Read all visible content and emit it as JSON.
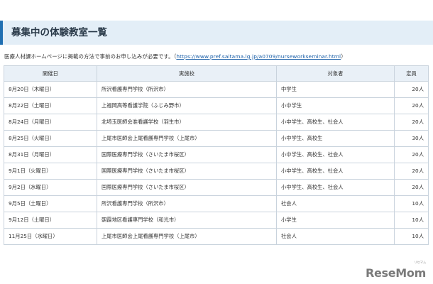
{
  "page_title": "募集中の体験教室一覧",
  "intro": {
    "text": "医療人材課ホームページに掲載の方法で事前のお申し込みが必要です。（",
    "link": "https://www.pref.saitama.lg.jp/a0709/nurseworkseminar.html",
    "suffix": "）"
  },
  "table": {
    "headers": {
      "date": "開催日",
      "school": "実施校",
      "target": "対象者",
      "capacity": "定員"
    },
    "rows": [
      {
        "date": "8月20日（木曜日）",
        "school": "所沢看護専門学校（所沢市）",
        "target": "中学生",
        "capacity": "20人"
      },
      {
        "date": "8月22日（土曜日）",
        "school": "上福岡高等看護学院（ふじみ野市）",
        "target": "小中学生",
        "capacity": "20人"
      },
      {
        "date": "8月24日（月曜日）",
        "school": "北埼玉医師会准看護学校（羽生市）",
        "target": "小中学生、高校生、社会人",
        "capacity": "20人"
      },
      {
        "date": "8月25日（火曜日）",
        "school": "上尾市医師会上尾看護専門学校（上尾市）",
        "target": "小中学生、高校生",
        "capacity": "30人"
      },
      {
        "date": "8月31日（月曜日）",
        "school": "国際医療専門学校（さいたま市桜区）",
        "target": "小中学生、高校生、社会人",
        "capacity": "20人"
      },
      {
        "date": "9月1日（火曜日）",
        "school": "国際医療専門学校（さいたま市桜区）",
        "target": "小中学生、高校生、社会人",
        "capacity": "20人"
      },
      {
        "date": "9月2日（水曜日）",
        "school": "国際医療専門学校（さいたま市桜区）",
        "target": "小中学生、高校生、社会人",
        "capacity": "20人"
      },
      {
        "date": "9月5日（土曜日）",
        "school": "所沢看護専門学校（所沢市）",
        "target": "社会人",
        "capacity": "10人"
      },
      {
        "date": "9月12日（土曜日）",
        "school": "朝霞地区看護専門学校（和光市）",
        "target": "小学生",
        "capacity": "10人"
      },
      {
        "date": "11月25日（水曜日）",
        "school": "上尾市医師会上尾看護専門学校（上尾市）",
        "target": "社会人",
        "capacity": "10人"
      }
    ]
  },
  "logo": {
    "text": "ReseMom",
    "small": "リセマム"
  }
}
